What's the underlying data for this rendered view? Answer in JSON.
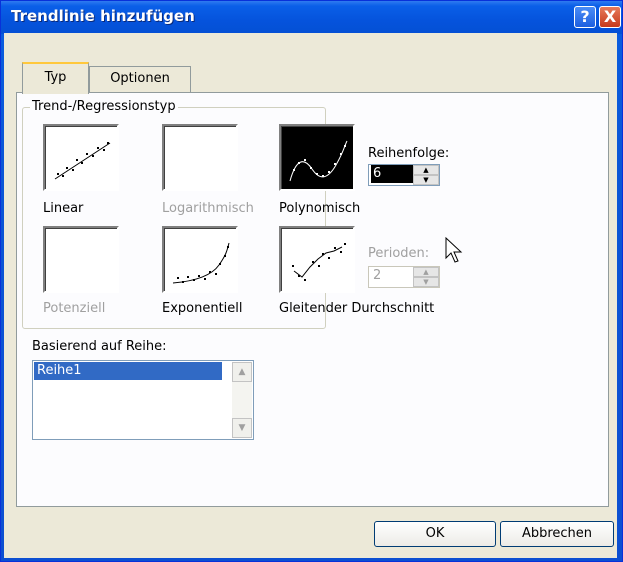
{
  "window": {
    "title": "Trendlinie hinzufügen"
  },
  "titlebar_buttons": {
    "help": "?",
    "close": "X"
  },
  "tabs": [
    {
      "label": "Typ",
      "selected": true
    },
    {
      "label": "Optionen",
      "selected": false
    }
  ],
  "trend_group": {
    "label": "Trend-/Regressionstyp",
    "types": [
      {
        "id": "linear",
        "label": "Linear",
        "enabled": true,
        "selected": false,
        "icon": "linear-trend-icon"
      },
      {
        "id": "log",
        "label": "Logarithmisch",
        "enabled": false,
        "selected": false,
        "icon": "blank-icon"
      },
      {
        "id": "poly",
        "label": "Polynomisch",
        "enabled": true,
        "selected": true,
        "icon": "polynomial-trend-icon"
      },
      {
        "id": "power",
        "label": "Potenziell",
        "enabled": false,
        "selected": false,
        "icon": "blank-icon"
      },
      {
        "id": "exp",
        "label": "Exponentiell",
        "enabled": true,
        "selected": false,
        "icon": "exponential-trend-icon"
      },
      {
        "id": "ma",
        "label": "Gleitender Durchschnitt",
        "enabled": true,
        "selected": false,
        "icon": "moving-average-icon"
      }
    ]
  },
  "order": {
    "label": "Reihenfolge:",
    "value": "6"
  },
  "period": {
    "label": "Perioden:",
    "value": "2",
    "enabled": false
  },
  "series": {
    "label": "Basierend auf Reihe:",
    "items": [
      "Reihe1"
    ],
    "selected": "Reihe1"
  },
  "buttons": {
    "ok": "OK",
    "cancel": "Abbrechen"
  },
  "colors": {
    "titlebar": "#0a5fe8",
    "dialog": "#ece9d8",
    "selection": "#316ac5"
  }
}
